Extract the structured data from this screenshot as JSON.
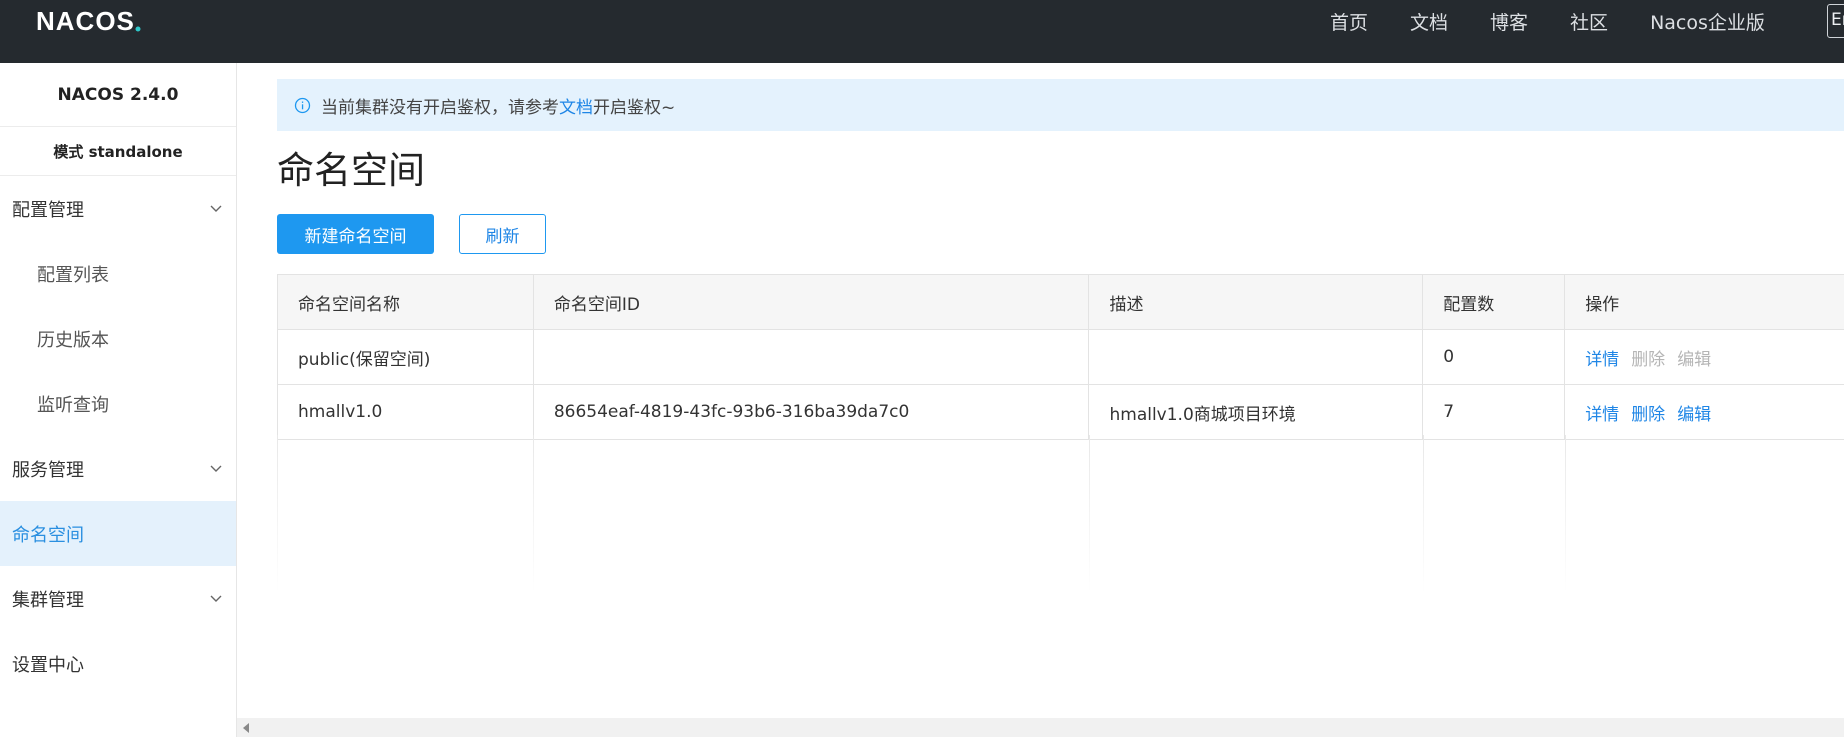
{
  "header": {
    "logo_text": "NACOS.",
    "nav": [
      "首页",
      "文档",
      "博客",
      "社区",
      "Nacos企业版"
    ],
    "lang_button": "En"
  },
  "sidebar": {
    "version": "NACOS 2.4.0",
    "mode": "模式 standalone",
    "items": [
      {
        "label": "配置管理",
        "type": "group",
        "icon": "chevron-down-icon"
      },
      {
        "label": "配置列表",
        "type": "sub"
      },
      {
        "label": "历史版本",
        "type": "sub"
      },
      {
        "label": "监听查询",
        "type": "sub"
      },
      {
        "label": "服务管理",
        "type": "group",
        "icon": "chevron-down-icon"
      },
      {
        "label": "命名空间",
        "type": "active"
      },
      {
        "label": "集群管理",
        "type": "group",
        "icon": "chevron-down-icon"
      },
      {
        "label": "设置中心",
        "type": "item"
      }
    ]
  },
  "notice": {
    "icon": "info-icon",
    "prefix": "当前集群没有开启鉴权，请参考",
    "link": "文档",
    "suffix": "开启鉴权~"
  },
  "page": {
    "title": "命名空间",
    "new_button": "新建命名空间",
    "refresh_button": "刷新"
  },
  "table": {
    "columns": [
      "命名空间名称",
      "命名空间ID",
      "描述",
      "配置数",
      "操作"
    ],
    "rows": [
      {
        "name": "public(保留空间)",
        "id": "",
        "desc": "",
        "count": "0",
        "ops": [
          "详情",
          "删除",
          "编辑"
        ],
        "ops_enabled": [
          true,
          false,
          false
        ]
      },
      {
        "name": "hmallv1.0",
        "id": "86654eaf-4819-43fc-93b6-316ba39da7c0",
        "desc": "hmallv1.0商城项目环境",
        "count": "7",
        "ops": [
          "详情",
          "删除",
          "编辑"
        ],
        "ops_enabled": [
          true,
          true,
          true
        ]
      }
    ]
  },
  "colors": {
    "header_bg": "#252a2f",
    "accent": "#1e98f0",
    "link": "#1f86e6",
    "active_bg": "#e4f1fc",
    "notice_bg": "#e4f2fd"
  }
}
